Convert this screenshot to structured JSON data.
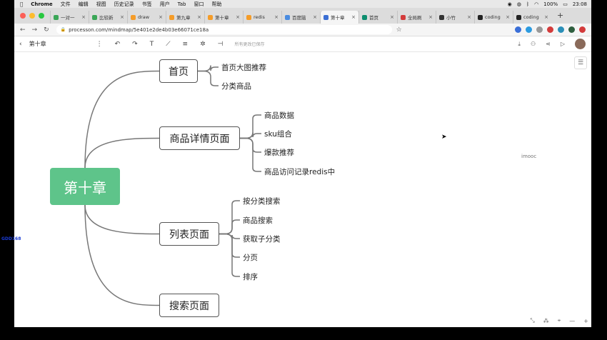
{
  "menubar": {
    "app": "Chrome",
    "items": [
      "文件",
      "编辑",
      "视图",
      "历史记录",
      "书签",
      "用户",
      "Tab",
      "窗口",
      "帮助"
    ],
    "battery": "100%",
    "time": "23:08"
  },
  "tabs": [
    {
      "label": "一对一",
      "color": "#3aa657"
    },
    {
      "label": "比较新",
      "color": "#3aa657"
    },
    {
      "label": "draw",
      "color": "#f59c28"
    },
    {
      "label": "第九章",
      "color": "#f59c28"
    },
    {
      "label": "第十章",
      "color": "#f59c28"
    },
    {
      "label": "redis",
      "color": "#f59c28"
    },
    {
      "label": "百度脑",
      "color": "#4a8ce0"
    },
    {
      "label": "第十章",
      "color": "#3b6fd4",
      "active": true
    },
    {
      "label": "首页",
      "color": "#0c8d6e"
    },
    {
      "label": "全局刷",
      "color": "#d33b3b"
    },
    {
      "label": "小竹",
      "color": "#333333"
    },
    {
      "label": "coding",
      "color": "#222222"
    },
    {
      "label": "coding",
      "color": "#222222"
    }
  ],
  "address": {
    "url": "processon.com/mindmap/5e401e2de4b03e66071ce18a"
  },
  "toolbar": {
    "title": "第十章",
    "saved": "所有更改已保存"
  },
  "mindmap": {
    "root": "第十章",
    "branches": [
      {
        "label": "首页",
        "children": [
          "首页大图推荐",
          "分类商品"
        ]
      },
      {
        "label": "商品详情页面",
        "children": [
          "商品数据",
          "sku组合",
          "爆款推荐",
          "商品访问记录redis中"
        ]
      },
      {
        "label": "列表页面",
        "children": [
          "按分类搜索",
          "商品搜索",
          "获取子分类",
          "分页",
          "排序"
        ]
      },
      {
        "label": "搜索页面",
        "children": []
      }
    ]
  },
  "watermark": "imooc",
  "overlay": "GDD168"
}
